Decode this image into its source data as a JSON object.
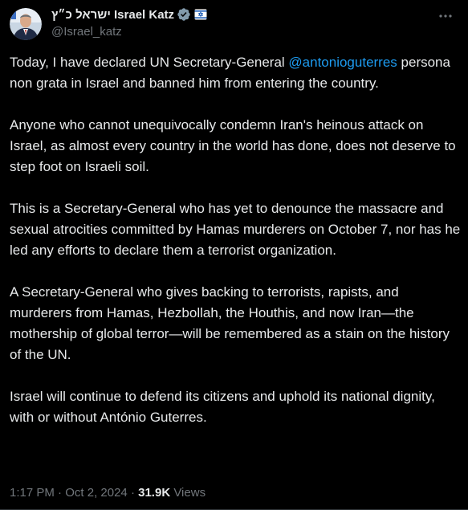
{
  "author": {
    "display_name": "ישראל כ״ץ Israel Katz",
    "handle": "@Israel_katz",
    "verified_icon": "verified-badge-icon",
    "affiliation_icon": "israel-gov-emblem-icon",
    "avatar_icon": "profile-photo"
  },
  "menu": {
    "more_icon": "more-horizontal-icon"
  },
  "tweet": {
    "p1_before": "Today, I have declared UN Secretary-General ",
    "p1_mention": "@antonioguterres",
    "p1_after": " persona non grata in Israel and banned him from entering the country.",
    "p2": "Anyone who cannot unequivocally condemn Iran's heinous attack on Israel, as almost every country in the world has done, does not deserve to step foot on Israeli soil.",
    "p3": "This is a Secretary-General who has yet to denounce the massacre and sexual atrocities committed by Hamas murderers on October 7, nor has he led any efforts to declare them a terrorist organization.",
    "p4": "A Secretary-General who gives backing to terrorists, rapists, and murderers from Hamas, Hezbollah, the Houthis, and now Iran—the mothership of global terror—will be remembered as a stain on the history of the UN.",
    "p5": "Israel will continue to defend its citizens and uphold its national dignity, with or without António Guterres."
  },
  "meta": {
    "time": "1:17 PM",
    "separator": " · ",
    "date": "Oct 2, 2024",
    "views_count": "31.9K",
    "views_label": " Views"
  },
  "colors": {
    "background": "#000000",
    "text": "#e7e9ea",
    "secondary": "#71767b",
    "accent": "#1d9bf0"
  }
}
